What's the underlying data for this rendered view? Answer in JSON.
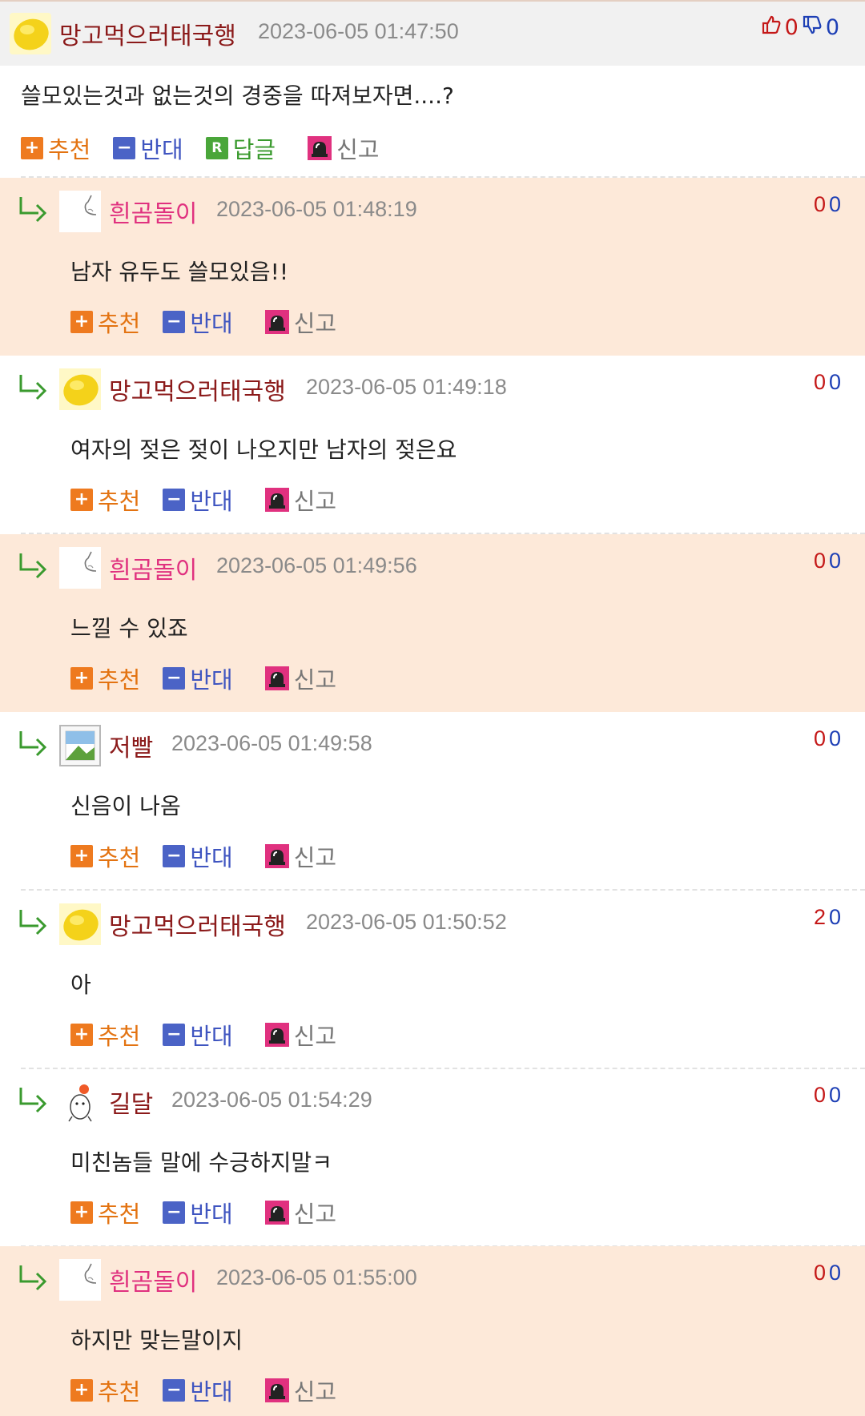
{
  "colors": {
    "reply_bg_pink": "#fde9d9",
    "author_red": "#8b1a1a",
    "author_pink": "#e0317f",
    "recommend_orange": "#ee7a1f",
    "oppose_blue": "#4b63c6",
    "reply_green": "#4aa63a",
    "upvote_red": "#c41818",
    "downvote_blue": "#1d3fb5"
  },
  "labels": {
    "recommend": "추천",
    "oppose": "반대",
    "reply": "답글",
    "report": "신고"
  },
  "post": {
    "author": "망고먹으러태국행",
    "avatar": "mango-avatar",
    "time": "2023-06-05 01:47:50",
    "up": "0",
    "down": "0",
    "body": "쓸모있는것과 없는것의 경중을 따져보자면....?"
  },
  "replies": [
    {
      "author": "흰곰돌이",
      "author_color": "#e0317f",
      "avatar": "sketch-avatar",
      "time": "2023-06-05 01:48:19",
      "votes": "0 0",
      "up_color": "#c41818",
      "body": "남자 유두도 쓸모있음!!",
      "bg": "pink"
    },
    {
      "author": "망고먹으러태국행",
      "author_color": "#8b1a1a",
      "avatar": "mango-avatar",
      "time": "2023-06-05 01:49:18",
      "votes": "0 0",
      "up_color": "#c41818",
      "body": "여자의 젖은 젖이 나오지만 남자의 젖은요",
      "bg": "white"
    },
    {
      "author": "흰곰돌이",
      "author_color": "#e0317f",
      "avatar": "sketch-avatar",
      "time": "2023-06-05 01:49:56",
      "votes": "0 0",
      "up_color": "#c41818",
      "body": "느낄 수 있죠",
      "bg": "pink"
    },
    {
      "author": "저빨",
      "author_color": "#8b1a1a",
      "avatar": "broken-image-avatar",
      "time": "2023-06-05 01:49:58",
      "votes": "0 0",
      "up_color": "#c41818",
      "body": "신음이 나옴",
      "bg": "white"
    },
    {
      "author": "망고먹으러태국행",
      "author_color": "#8b1a1a",
      "avatar": "mango-avatar",
      "time": "2023-06-05 01:50:52",
      "votes": "2 0",
      "up_color": "#c41818",
      "body": "아",
      "bg": "white"
    },
    {
      "author": "길달",
      "author_color": "#8b1a1a",
      "avatar": "hamster-avatar",
      "time": "2023-06-05 01:54:29",
      "votes": "0 0",
      "up_color": "#c41818",
      "body": "미친놈들 말에 수긍하지말ㅋ",
      "bg": "white"
    },
    {
      "author": "흰곰돌이",
      "author_color": "#e0317f",
      "avatar": "sketch-avatar",
      "time": "2023-06-05 01:55:00",
      "votes": "0 0",
      "up_color": "#c41818",
      "body": "하지만 맞는말이지",
      "bg": "pink"
    }
  ]
}
